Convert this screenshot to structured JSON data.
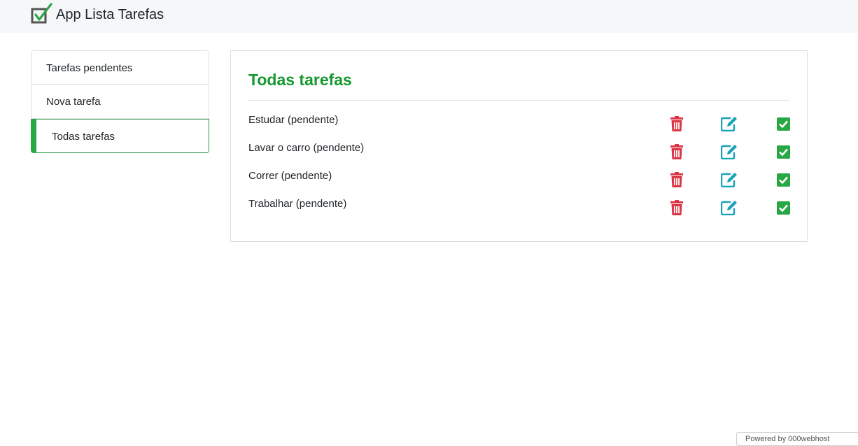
{
  "app": {
    "title": "App Lista Tarefas"
  },
  "sidebar": {
    "items": [
      {
        "label": "Tarefas pendentes"
      },
      {
        "label": "Nova tarefa"
      },
      {
        "label": "Todas tarefas"
      }
    ]
  },
  "main": {
    "title": "Todas tarefas",
    "tasks": [
      {
        "text": "Estudar (pendente)"
      },
      {
        "text": "Lavar o carro (pendente)"
      },
      {
        "text": "Correr (pendente)"
      },
      {
        "text": "Trabalhar (pendente)"
      }
    ]
  },
  "icons": {
    "trash": "trash-icon",
    "edit": "edit-icon",
    "check": "check-square-icon",
    "logo": "checkmark-logo-icon"
  },
  "colors": {
    "accent": "#15992f",
    "active_border": "#28a745",
    "danger": "#dc3545",
    "info": "#17a2b8",
    "success": "#28a745"
  },
  "footer": {
    "powered": "Powered by 000webhost"
  }
}
